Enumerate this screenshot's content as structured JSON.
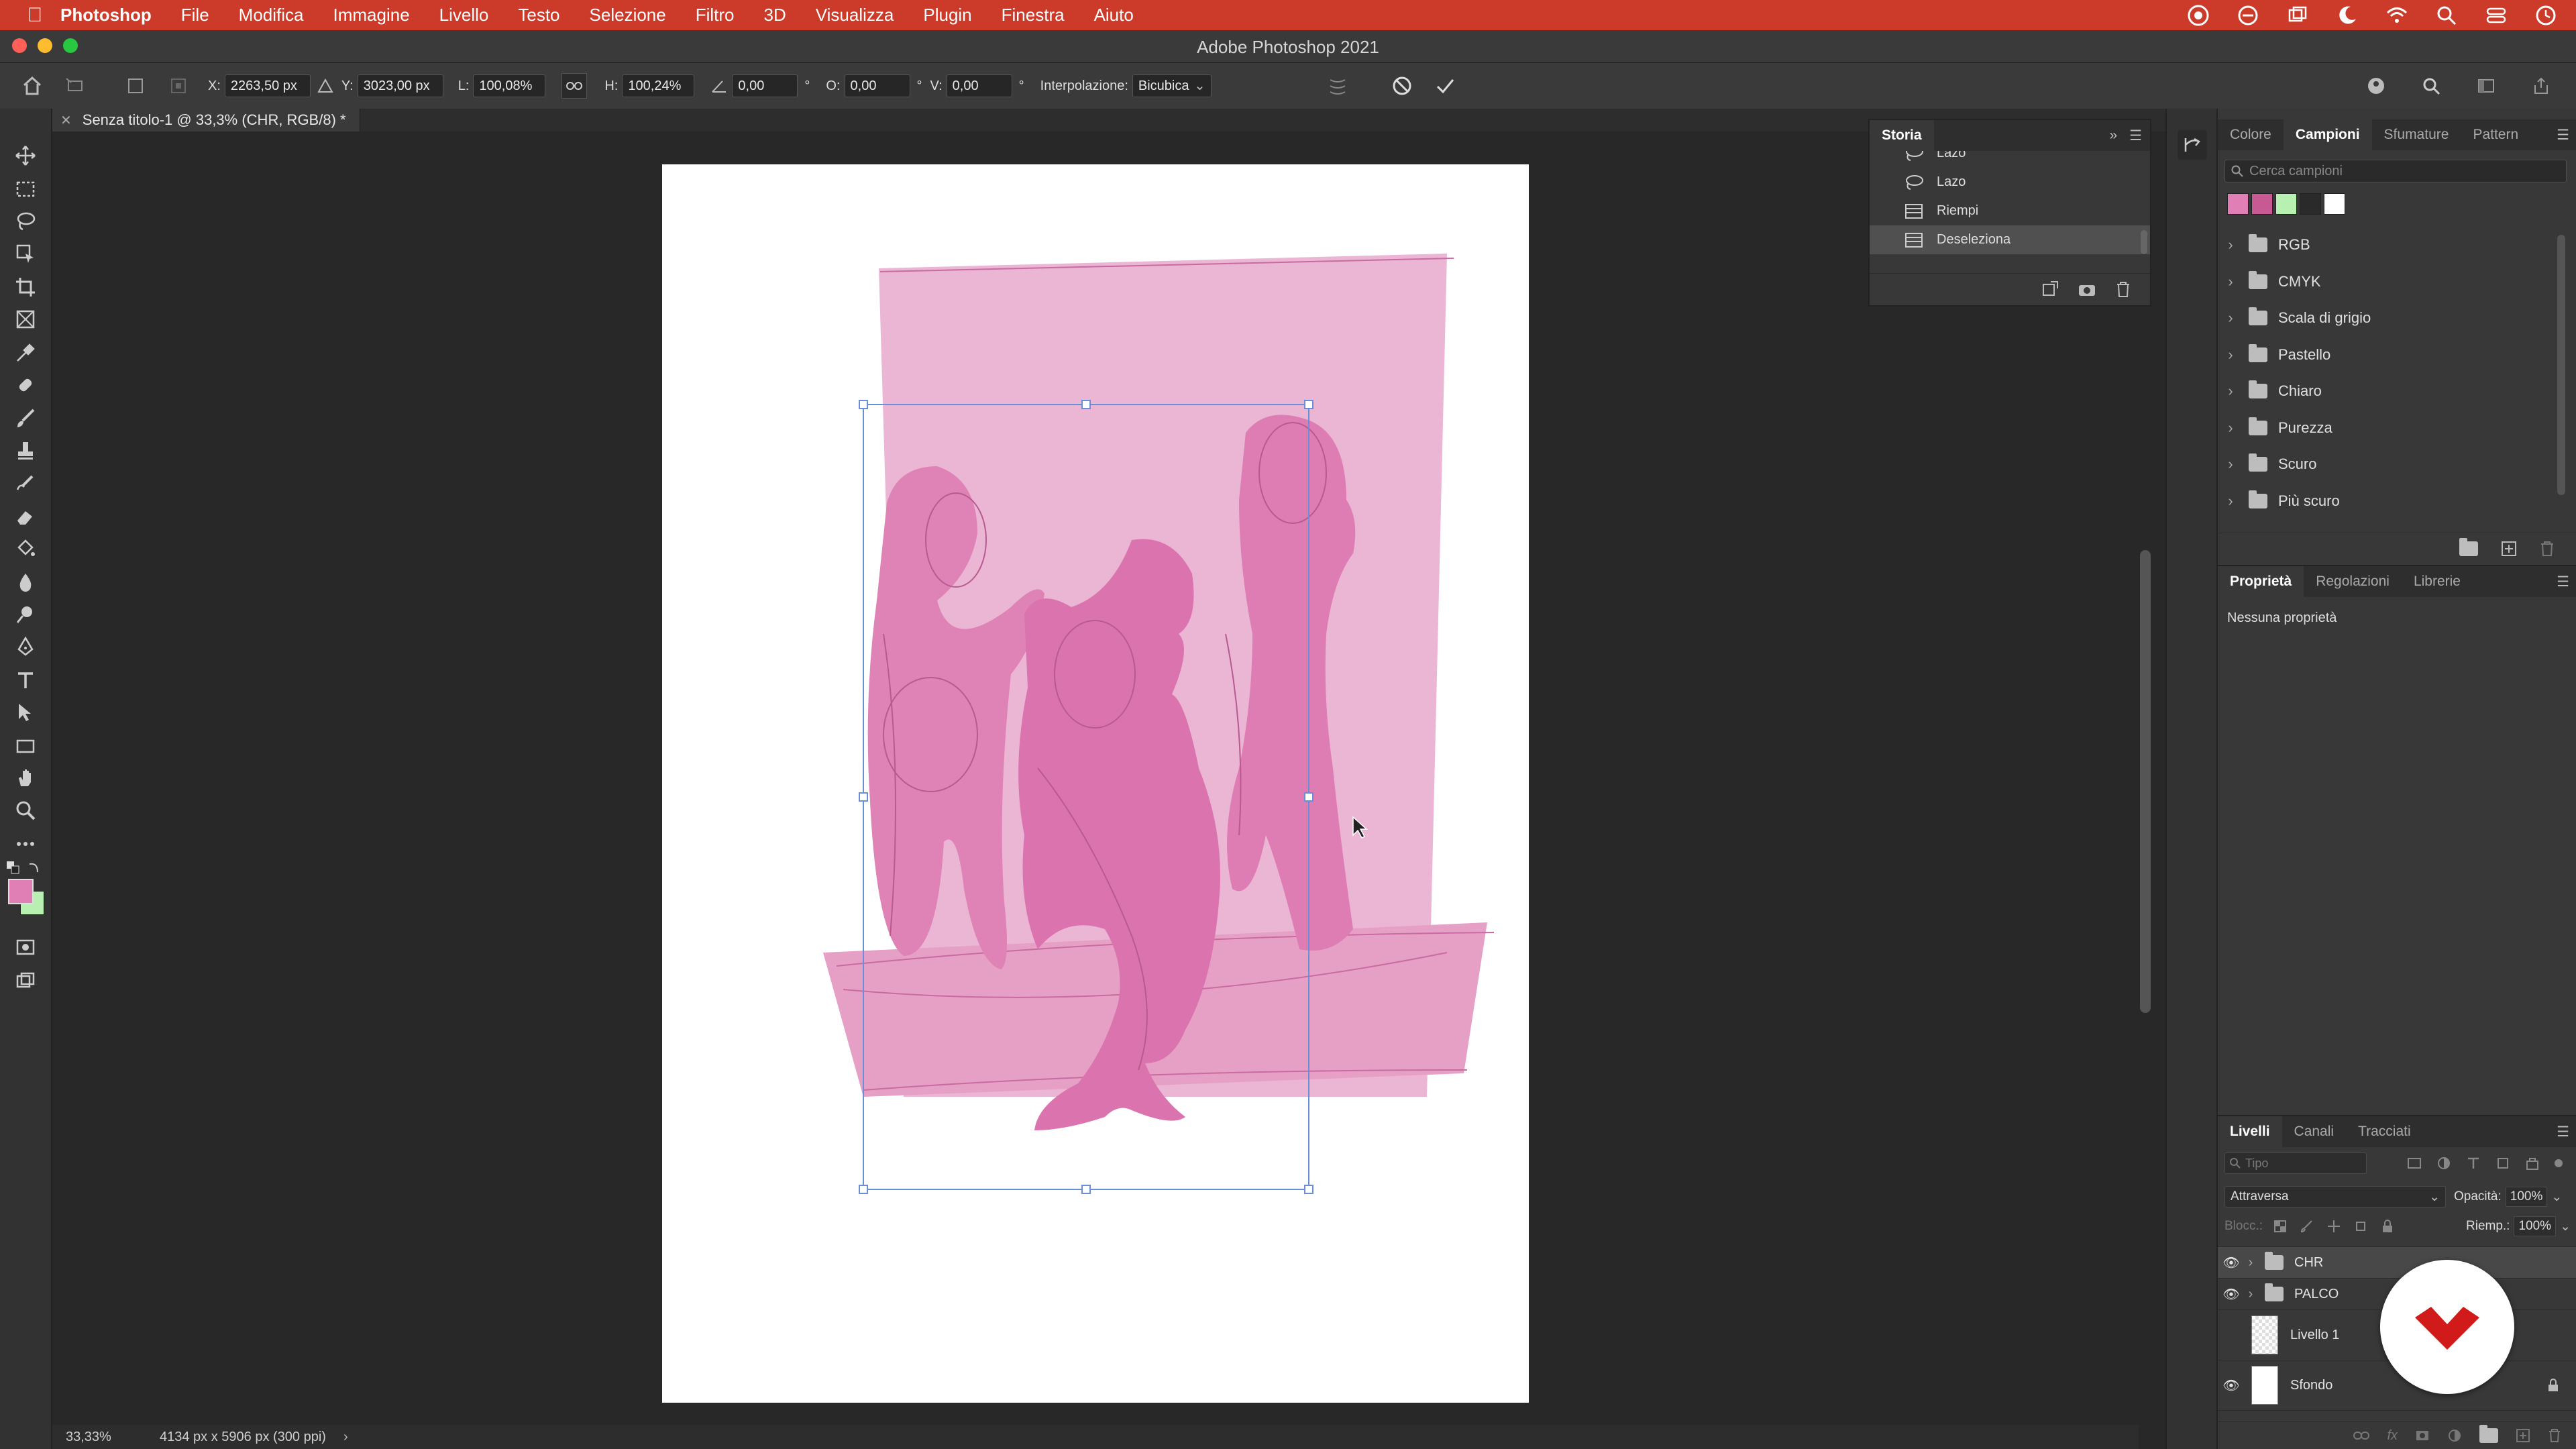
{
  "menubar": {
    "app": "Photoshop",
    "items": [
      "File",
      "Modifica",
      "Immagine",
      "Livello",
      "Testo",
      "Selezione",
      "Filtro",
      "3D",
      "Visualizza",
      "Plugin",
      "Finestra",
      "Aiuto"
    ]
  },
  "window": {
    "title": "Adobe Photoshop 2021"
  },
  "options": {
    "x_label": "X:",
    "x_value": "2263,50 px",
    "y_label": "Y:",
    "y_value": "3023,00 px",
    "w_label": "L:",
    "w_value": "100,08%",
    "h_label": "H:",
    "h_value": "100,24%",
    "angle_value": "0,00",
    "angle_unit": "°",
    "o_label": "O:",
    "o_value": "0,00",
    "o_unit": "°",
    "v_label": "V:",
    "v_value": "0,00",
    "v_unit": "°",
    "interp_label": "Interpolazione:",
    "interp_value": "Bicubica"
  },
  "document": {
    "tab_title": "Senza titolo-1 @ 33,3% (CHR, RGB/8) *"
  },
  "status": {
    "zoom": "33,33%",
    "info": "4134 px x 5906 px (300 ppi)"
  },
  "history": {
    "tab": "Storia",
    "items": [
      {
        "label": "Lazo",
        "icon": "lasso-icon"
      },
      {
        "label": "Lazo",
        "icon": "lasso-icon"
      },
      {
        "label": "Riempi",
        "icon": "fill-icon"
      },
      {
        "label": "Deseleziona",
        "icon": "deselect-icon"
      }
    ]
  },
  "swatches": {
    "tabs": [
      "Colore",
      "Campioni",
      "Sfumature",
      "Pattern"
    ],
    "active_tab": "Campioni",
    "search_placeholder": "Cerca campioni",
    "recent": [
      "#e07fb5",
      "#c85a93",
      "#b7f0b0",
      "#2a2a2a",
      "#ffffff"
    ],
    "groups": [
      "RGB",
      "CMYK",
      "Scala di grigio",
      "Pastello",
      "Chiaro",
      "Purezza",
      "Scuro",
      "Più scuro"
    ]
  },
  "properties": {
    "tabs": [
      "Proprietà",
      "Regolazioni",
      "Librerie"
    ],
    "empty_text": "Nessuna proprietà"
  },
  "layers": {
    "tabs": [
      "Livelli",
      "Canali",
      "Tracciati"
    ],
    "filter_placeholder": "Tipo",
    "blend_mode": "Attraversa",
    "opacity_label": "Opacità:",
    "opacity_value": "100%",
    "lock_label": "Blocc.:",
    "fill_label": "Riemp.:",
    "fill_value": "100%",
    "items": [
      {
        "name": "CHR",
        "type": "group",
        "visible": true,
        "selected": true
      },
      {
        "name": "PALCO",
        "type": "group",
        "visible": true
      },
      {
        "name": "Livello 1",
        "type": "layer",
        "visible": false
      },
      {
        "name": "Sfondo",
        "type": "background",
        "visible": true,
        "locked": true
      }
    ]
  },
  "colors": {
    "foreground": "#e07fb5",
    "background": "#b7f0b0",
    "accent": "#cc3a2a",
    "art_pink": "#e483b8"
  }
}
